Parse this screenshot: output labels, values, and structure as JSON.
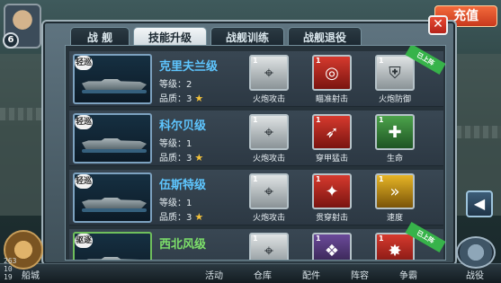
{
  "header": {
    "level": "6",
    "recharge_label": "充值",
    "close_label": "✕"
  },
  "tabs": [
    {
      "label": "战 舰"
    },
    {
      "label": "技能升级"
    },
    {
      "label": "战舰训练"
    },
    {
      "label": "战舰退役"
    }
  ],
  "rows": [
    {
      "type_badge": "轻巡",
      "name": "克里夫兰级",
      "level": "等级：2",
      "quality": "品质：3",
      "skills": [
        {
          "lv": "1",
          "label": "火炮攻击",
          "icon": "gun-turret-icon",
          "color": "gray"
        },
        {
          "lv": "1",
          "label": "瞄准射击",
          "icon": "target-cannon-icon",
          "color": "red"
        },
        {
          "lv": "1",
          "label": "火炮防御",
          "icon": "defense-turret-icon",
          "color": "gray"
        }
      ],
      "ribbon": "已上阵"
    },
    {
      "type_badge": "轻巡",
      "name": "科尔贝级",
      "level": "等级：1",
      "quality": "品质：3",
      "skills": [
        {
          "lv": "1",
          "label": "火炮攻击",
          "icon": "gun-turret-icon",
          "color": "gray"
        },
        {
          "lv": "1",
          "label": "穿甲猛击",
          "icon": "shell-icon",
          "color": "red"
        },
        {
          "lv": "1",
          "label": "生命",
          "icon": "health-cross-icon",
          "color": "green"
        }
      ]
    },
    {
      "type_badge": "轻巡",
      "name": "伍斯特级",
      "level": "等级：1",
      "quality": "品质：3",
      "skills": [
        {
          "lv": "1",
          "label": "火炮攻击",
          "icon": "gun-turret-icon",
          "color": "gray"
        },
        {
          "lv": "1",
          "label": "贯穿射击",
          "icon": "pierce-shot-icon",
          "color": "red"
        },
        {
          "lv": "1",
          "label": "速度",
          "icon": "speed-arrows-icon",
          "color": "yellow"
        }
      ]
    },
    {
      "type_badge": "驱逐",
      "name": "西北风级",
      "skills": [
        {
          "lv": "1",
          "icon": "gun-turret-icon",
          "color": "gray"
        },
        {
          "lv": "1",
          "icon": "purple-skill-icon",
          "color": "purple"
        },
        {
          "lv": "1",
          "icon": "red-skill-icon",
          "color": "red"
        }
      ],
      "ribbon": "已上阵"
    }
  ],
  "bottom_nav": [
    "活动",
    "仓库",
    "配件",
    "阵容",
    "争霸",
    "战役"
  ],
  "bottom_left_label": "船城",
  "coords": "263\n10\n19",
  "colors": {
    "accent_cyan": "#5ec6ff",
    "recharge_red": "#e04a2c",
    "ribbon_green": "#37b34a"
  }
}
